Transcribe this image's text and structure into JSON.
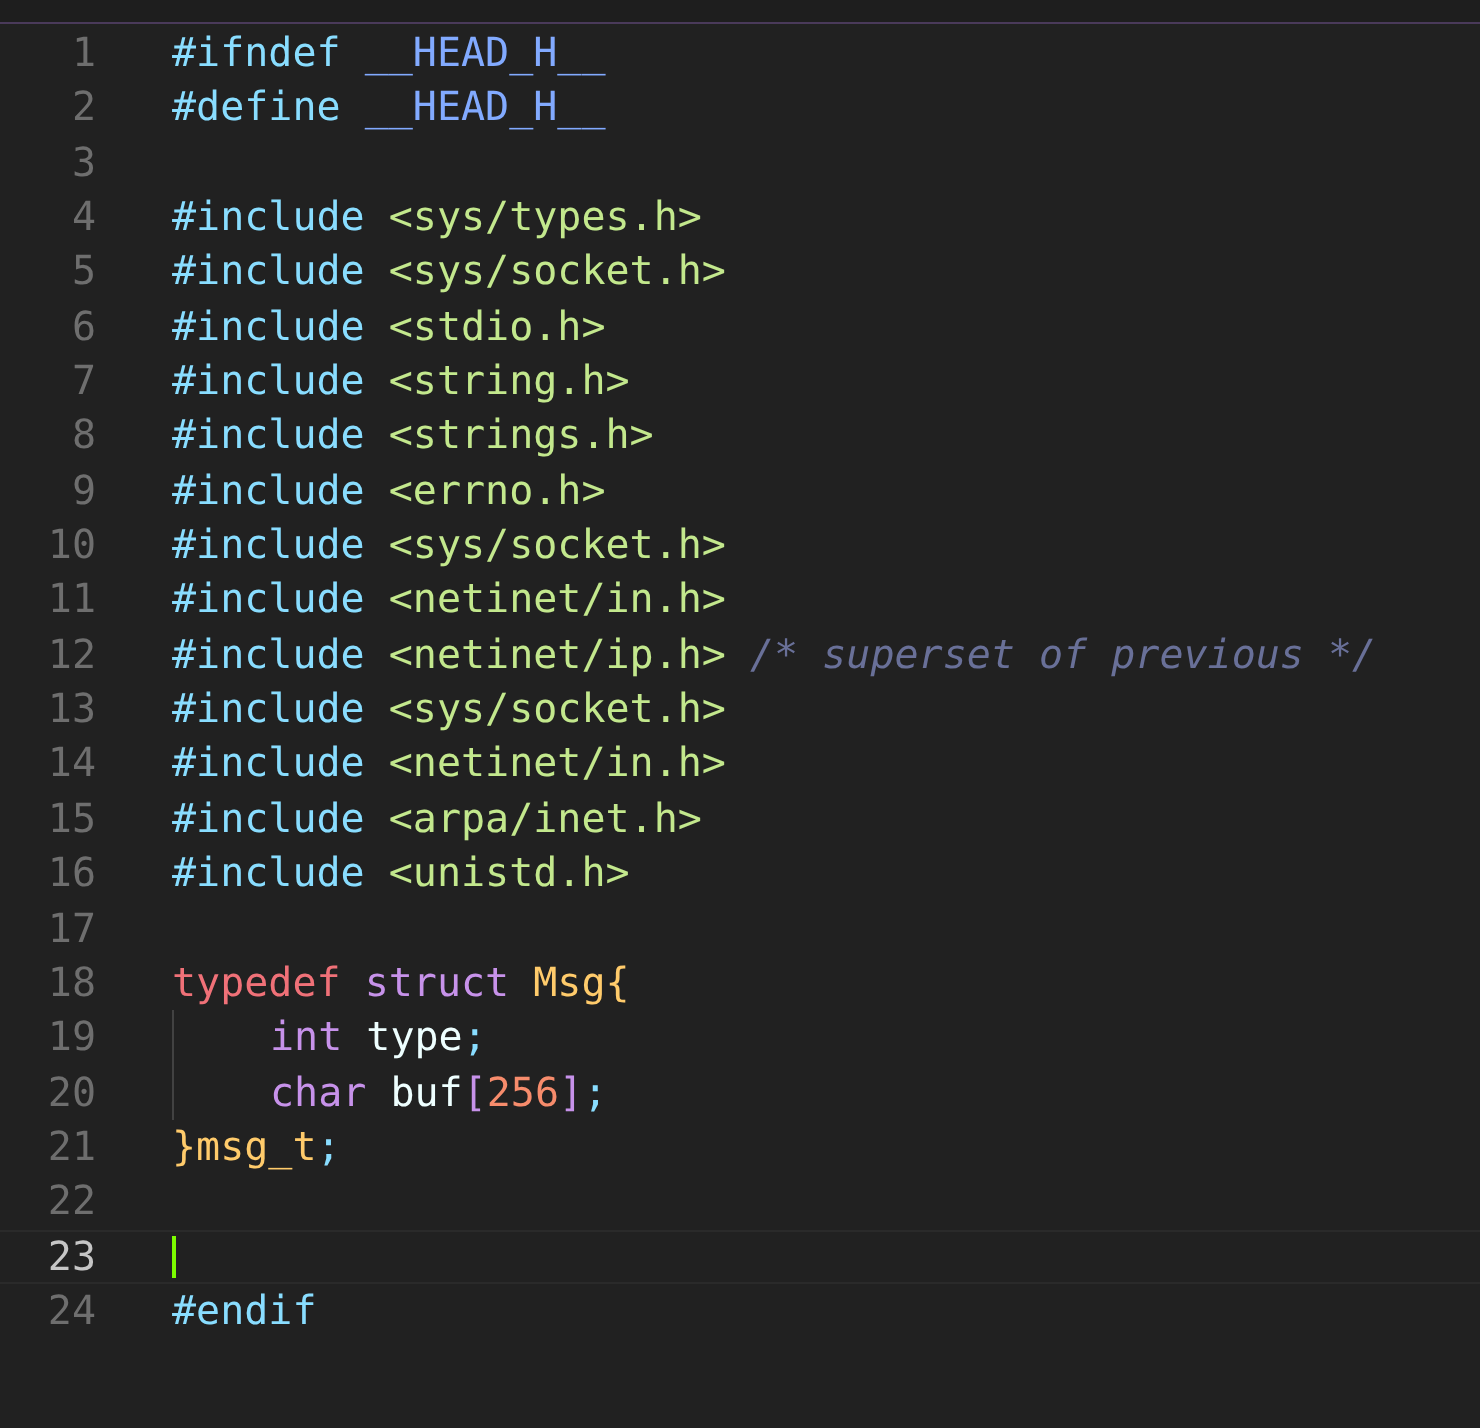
{
  "editor": {
    "lines": [
      {
        "number": "1",
        "current": false,
        "guide": false,
        "tokens": [
          {
            "text": "#ifndef ",
            "kind": "directive"
          },
          {
            "text": "__HEAD_H__",
            "kind": "macro"
          }
        ]
      },
      {
        "number": "2",
        "current": false,
        "guide": false,
        "tokens": [
          {
            "text": "#define ",
            "kind": "directive"
          },
          {
            "text": "__HEAD_H__",
            "kind": "macro"
          }
        ]
      },
      {
        "number": "3",
        "current": false,
        "guide": false
      },
      {
        "number": "4",
        "current": false,
        "guide": false,
        "tokens": [
          {
            "text": "#include ",
            "kind": "directive"
          },
          {
            "text": "<sys/types.h>",
            "kind": "header"
          }
        ]
      },
      {
        "number": "5",
        "current": false,
        "guide": false,
        "tokens": [
          {
            "text": "#include ",
            "kind": "directive"
          },
          {
            "text": "<sys/socket.h>",
            "kind": "header"
          }
        ]
      },
      {
        "number": "6",
        "current": false,
        "guide": false,
        "tokens": [
          {
            "text": "#include ",
            "kind": "directive"
          },
          {
            "text": "<stdio.h>",
            "kind": "header"
          }
        ]
      },
      {
        "number": "7",
        "current": false,
        "guide": false,
        "tokens": [
          {
            "text": "#include ",
            "kind": "directive"
          },
          {
            "text": "<string.h>",
            "kind": "header"
          }
        ]
      },
      {
        "number": "8",
        "current": false,
        "guide": false,
        "tokens": [
          {
            "text": "#include ",
            "kind": "directive"
          },
          {
            "text": "<strings.h>",
            "kind": "header"
          }
        ]
      },
      {
        "number": "9",
        "current": false,
        "guide": false,
        "tokens": [
          {
            "text": "#include ",
            "kind": "directive"
          },
          {
            "text": "<errno.h>",
            "kind": "header"
          }
        ]
      },
      {
        "number": "10",
        "current": false,
        "guide": false,
        "tokens": [
          {
            "text": "#include ",
            "kind": "directive"
          },
          {
            "text": "<sys/socket.h>",
            "kind": "header"
          }
        ]
      },
      {
        "number": "11",
        "current": false,
        "guide": false,
        "tokens": [
          {
            "text": "#include ",
            "kind": "directive"
          },
          {
            "text": "<netinet/in.h>",
            "kind": "header"
          }
        ]
      },
      {
        "number": "12",
        "current": false,
        "guide": false,
        "tokens": [
          {
            "text": "#include ",
            "kind": "directive"
          },
          {
            "text": "<netinet/ip.h> ",
            "kind": "header"
          },
          {
            "text": "/* superset of previous */",
            "kind": "comment"
          }
        ]
      },
      {
        "number": "13",
        "current": false,
        "guide": false,
        "tokens": [
          {
            "text": "#include ",
            "kind": "directive"
          },
          {
            "text": "<sys/socket.h>",
            "kind": "header"
          }
        ]
      },
      {
        "number": "14",
        "current": false,
        "guide": false,
        "tokens": [
          {
            "text": "#include ",
            "kind": "directive"
          },
          {
            "text": "<netinet/in.h>",
            "kind": "header"
          }
        ]
      },
      {
        "number": "15",
        "current": false,
        "guide": false,
        "tokens": [
          {
            "text": "#include ",
            "kind": "directive"
          },
          {
            "text": "<arpa/inet.h>",
            "kind": "header"
          }
        ]
      },
      {
        "number": "16",
        "current": false,
        "guide": false,
        "tokens": [
          {
            "text": "#include ",
            "kind": "directive"
          },
          {
            "text": "<unistd.h>",
            "kind": "header"
          }
        ]
      },
      {
        "number": "17",
        "current": false,
        "guide": false
      },
      {
        "number": "18",
        "current": false,
        "guide": false,
        "tokens": [
          {
            "text": "typedef ",
            "kind": "keyword"
          },
          {
            "text": "struct ",
            "kind": "storage"
          },
          {
            "text": "Msg",
            "kind": "type"
          },
          {
            "text": "{",
            "kind": "brace"
          }
        ]
      },
      {
        "number": "19",
        "current": false,
        "guide": true,
        "tokens": [
          {
            "text": "int ",
            "kind": "storage"
          },
          {
            "text": "type",
            "kind": "plain"
          },
          {
            "text": ";",
            "kind": "punct"
          }
        ]
      },
      {
        "number": "20",
        "current": false,
        "guide": true,
        "tokens": [
          {
            "text": "char ",
            "kind": "storage"
          },
          {
            "text": "buf",
            "kind": "plain"
          },
          {
            "text": "[",
            "kind": "bracket"
          },
          {
            "text": "256",
            "kind": "number"
          },
          {
            "text": "]",
            "kind": "bracket"
          },
          {
            "text": ";",
            "kind": "punct"
          }
        ]
      },
      {
        "number": "21",
        "current": false,
        "guide": false,
        "tokens": [
          {
            "text": "}",
            "kind": "brace"
          },
          {
            "text": "msg_t",
            "kind": "type"
          },
          {
            "text": ";",
            "kind": "punct"
          }
        ]
      },
      {
        "number": "22",
        "current": false,
        "guide": false
      },
      {
        "number": "23",
        "current": true,
        "guide": false
      },
      {
        "number": "24",
        "current": false,
        "guide": false,
        "tokens": [
          {
            "text": "#endif",
            "kind": "directive"
          }
        ]
      }
    ]
  }
}
